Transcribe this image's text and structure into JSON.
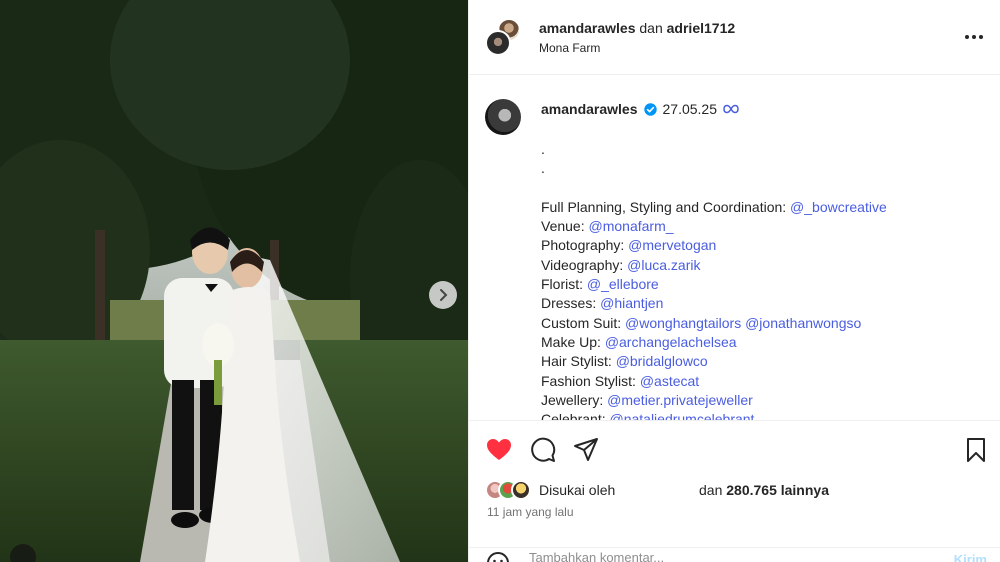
{
  "header": {
    "user1": "amandarawles",
    "conj": "dan",
    "user2": "adriel1712",
    "location": "Mona Farm",
    "more_icon": "more-horizontal-icon"
  },
  "caption": {
    "username": "amandarawles",
    "verified_icon": "verified-badge-icon",
    "date": "27.05.25",
    "collab_icon": "threads-icon",
    "dots": [
      ".",
      "."
    ],
    "credits": [
      {
        "label": "Full Planning, Styling and Coordination: ",
        "mentions": [
          "@_bowcreative"
        ]
      },
      {
        "label": "Venue: ",
        "mentions": [
          "@monafarm_"
        ]
      },
      {
        "label": "Photography: ",
        "mentions": [
          "@mervetogan"
        ]
      },
      {
        "label": "Videography: ",
        "mentions": [
          "@luca.zarik"
        ]
      },
      {
        "label": "Florist: ",
        "mentions": [
          "@_ellebore"
        ]
      },
      {
        "label": "Dresses: ",
        "mentions": [
          "@hiantjen"
        ]
      },
      {
        "label": "Custom Suit: ",
        "mentions": [
          "@wonghangtailors",
          "@jonathanwongso"
        ]
      },
      {
        "label": "Make Up: ",
        "mentions": [
          "@archangelachelsea"
        ]
      },
      {
        "label": "Hair Stylist: ",
        "mentions": [
          "@bridalglowco"
        ]
      },
      {
        "label": "Fashion Stylist: ",
        "mentions": [
          "@astecat"
        ]
      },
      {
        "label": "Jewellery: ",
        "mentions": [
          "@metier.privatejeweller"
        ]
      },
      {
        "label": "Celebrant: ",
        "mentions": [
          "@nataliedrumcelebrant"
        ]
      }
    ]
  },
  "actions": {
    "like_icon": "heart-filled-icon",
    "comment_icon": "comment-icon",
    "share_icon": "send-icon",
    "save_icon": "bookmark-icon",
    "like_color": "#ff3040"
  },
  "likes": {
    "liked_by": "Disukai oleh",
    "and": "dan",
    "count": "280.765 lainnya"
  },
  "time_ago": "11 jam yang lalu",
  "comment": {
    "placeholder": "Tambahkan komentar...",
    "send": "Kirim"
  },
  "media": {
    "next_icon": "chevron-right-icon"
  }
}
